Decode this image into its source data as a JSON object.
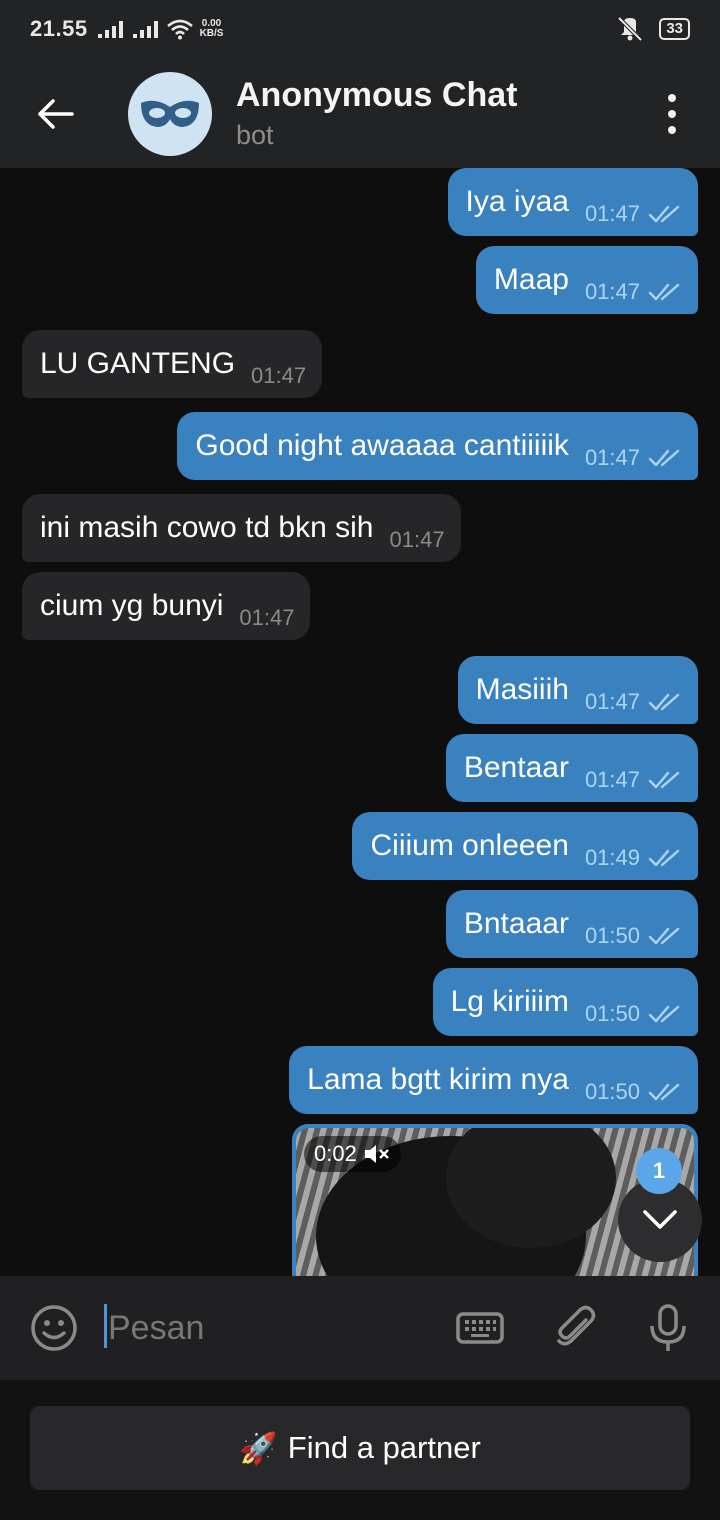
{
  "status_bar": {
    "time": "21.55",
    "net_speed_value": "0.00",
    "net_speed_unit": "KB/S",
    "battery": "33"
  },
  "header": {
    "title": "Anonymous Chat",
    "subtitle": "bot"
  },
  "messages": [
    {
      "dir": "out",
      "text": "Iya iyaa",
      "time": "01:47"
    },
    {
      "dir": "out",
      "text": "Maap",
      "time": "01:47"
    },
    {
      "dir": "in",
      "text": "LU GANTENG",
      "time": "01:47"
    },
    {
      "dir": "out",
      "text": "Good night awaaaa cantiiiiik",
      "time": "01:47"
    },
    {
      "dir": "in",
      "text": "ini masih cowo td bkn sih",
      "time": "01:47"
    },
    {
      "dir": "in",
      "text": "cium yg bunyi",
      "time": "01:47"
    },
    {
      "dir": "out",
      "text": "Masiiih",
      "time": "01:47"
    },
    {
      "dir": "out",
      "text": "Bentaar",
      "time": "01:47"
    },
    {
      "dir": "out",
      "text": "Ciiium onleeen",
      "time": "01:49"
    },
    {
      "dir": "out",
      "text": "Bntaaar",
      "time": "01:50"
    },
    {
      "dir": "out",
      "text": "Lg kiriiim",
      "time": "01:50"
    },
    {
      "dir": "out",
      "text": "Lama bgtt kirim nya",
      "time": "01:50"
    }
  ],
  "video": {
    "duration": "0:02"
  },
  "unread_badge": "1",
  "input": {
    "placeholder": "Pesan"
  },
  "find_button": {
    "emoji": "🚀",
    "label": "Find a partner"
  },
  "colors": {
    "outgoing_bubble": "#3a82bf",
    "incoming_bubble": "#262628",
    "background": "#0e0e0e",
    "accent": "#5aa6e8"
  }
}
